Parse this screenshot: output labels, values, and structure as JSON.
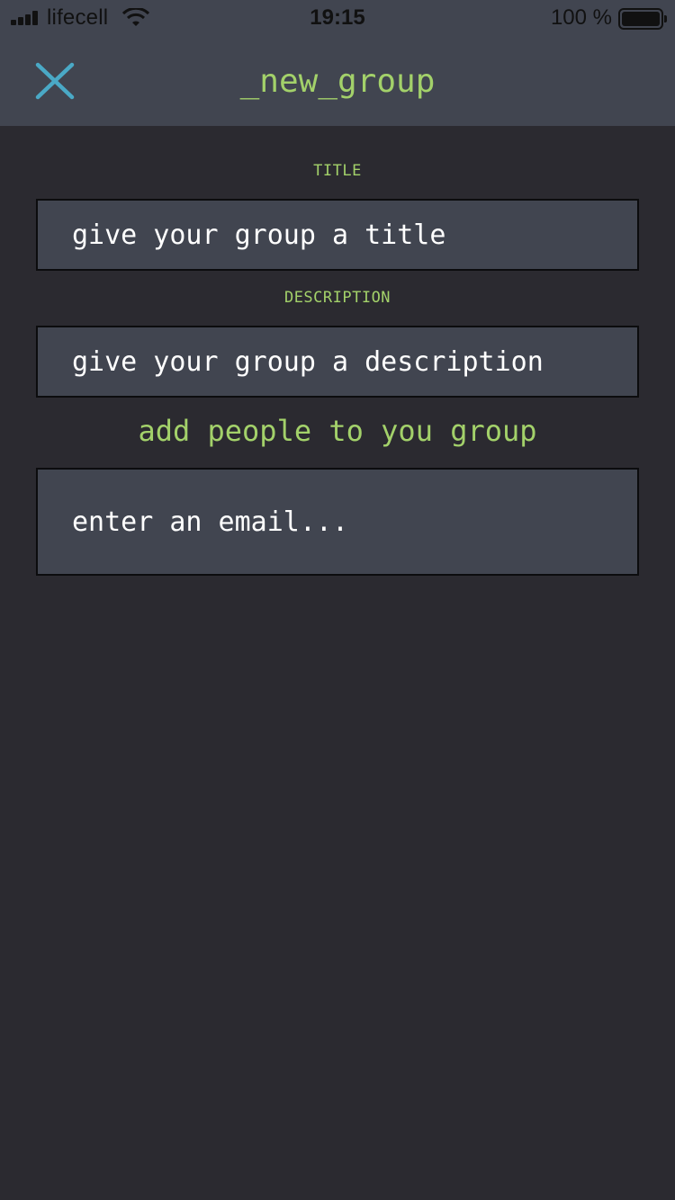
{
  "status_bar": {
    "carrier": "lifecell",
    "time": "19:15",
    "battery_percent": "100 %"
  },
  "nav": {
    "title": "_new_group",
    "close_icon": "close-icon",
    "close_color": "#4aa9c6"
  },
  "form": {
    "title_label": "TITLE",
    "title_placeholder": "give your group a title",
    "description_label": "DESCRIPTION",
    "description_placeholder": "give your group a description",
    "people_heading": "add people to you group",
    "email_placeholder": "enter an email..."
  },
  "colors": {
    "background": "#2b2a30",
    "header": "#414550",
    "accent": "#a3d16a",
    "field_bg": "#414550"
  }
}
